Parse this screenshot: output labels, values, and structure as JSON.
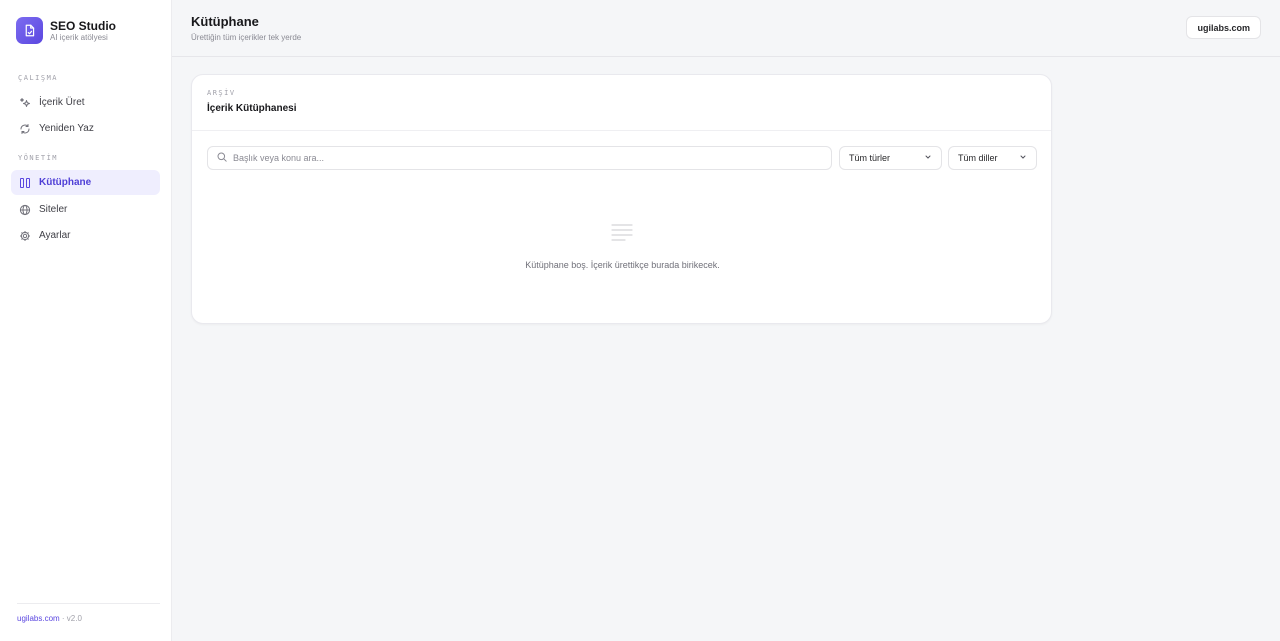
{
  "brand": {
    "name": "SEO Studio",
    "subtitle": "AI içerik atölyesi"
  },
  "sidebar": {
    "sections": [
      {
        "label": "ÇALIŞMA"
      },
      {
        "label": "YÖNETİM"
      }
    ],
    "items": [
      {
        "label": "İçerik Üret",
        "icon": "sparkles-icon"
      },
      {
        "label": "Yeniden Yaz",
        "icon": "refresh-icon"
      },
      {
        "label": "Kütüphane",
        "icon": "library-icon",
        "active": true
      },
      {
        "label": "Siteler",
        "icon": "globe-icon"
      },
      {
        "label": "Ayarlar",
        "icon": "gear-icon"
      }
    ],
    "footer": {
      "host": "ugilabs.com",
      "version": "· v2.0"
    }
  },
  "header": {
    "title": "Kütüphane",
    "subtitle": "Ürettiğin tüm içerikler tek yerde",
    "site_button": "ugilabs.com"
  },
  "card": {
    "eyebrow": "ARŞİV",
    "title": "İçerik Kütüphanesi",
    "search_placeholder": "Başlık veya konu ara...",
    "type_filter": "Tüm türler",
    "language_filter": "Tüm diller",
    "empty_message": "Kütüphane boş. İçerik ürettikçe burada birikecek."
  },
  "colors": {
    "accent": "#5b47e0",
    "active_bg": "#efeefe",
    "page_bg": "#f5f6f8"
  }
}
